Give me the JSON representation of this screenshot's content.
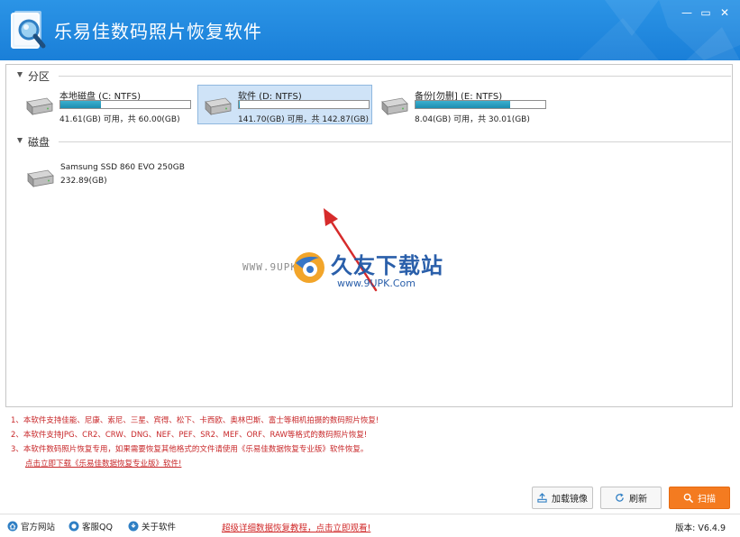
{
  "app": {
    "title": "乐易佳数码照片恢复软件",
    "window_controls": {
      "minimize": "—",
      "maximize": "▭",
      "close": "✕"
    }
  },
  "sections": {
    "partitions_label": "分区",
    "disks_label": "磁盘"
  },
  "partitions": [
    {
      "name": "本地磁盘 (C: NTFS)",
      "usage": "41.61(GB) 可用，共 60.00(GB)",
      "fill_pct": 31
    },
    {
      "name": "软件 (D: NTFS)",
      "usage": "141.70(GB) 可用，共 142.87(GB)",
      "fill_pct": 1,
      "selected": true
    },
    {
      "name": "备份[勿删] (E: NTFS)",
      "usage": "8.04(GB) 可用，共 30.01(GB)",
      "fill_pct": 73
    }
  ],
  "disks": [
    {
      "name": "Samsung SSD 860 EVO 250GB",
      "size": "232.89(GB)"
    }
  ],
  "watermark": {
    "site": "WWW.9UPK.COM",
    "name": "久友下载站",
    "url": "www.9UPK.Com"
  },
  "notes": [
    "1、本软件支持佳能、尼康、索尼、三星、宾得、松下、卡西欧、奥林巴斯、富士等相机拍摄的数码照片恢复!",
    "2、本软件支持JPG、CR2、CRW、DNG、NEF、PEF、SR2、MEF、ORF、RAW等格式的数码照片恢复!",
    "3、本软件数码照片恢复专用，如果需要恢复其他格式的文件请使用《乐易佳数据恢复专业版》软件恢复。"
  ],
  "notes_link": "点击立即下载《乐易佳数据恢复专业版》软件!",
  "buttons": {
    "load_image": "加载镜像",
    "refresh": "刷新",
    "scan": "扫描"
  },
  "footer": {
    "website": "官方网站",
    "support_qq": "客服QQ",
    "about": "关于软件",
    "tutorial_link": "超级详细数据恢复教程，点击立即观看!",
    "version": "版本: V6.4.9"
  },
  "colors": {
    "title_bar": "#1a7fd8",
    "selected_bg": "#cfe3f7",
    "bar_fill": "#1d8db0",
    "note_red": "#c8282a",
    "scan_orange": "#f47b20"
  }
}
